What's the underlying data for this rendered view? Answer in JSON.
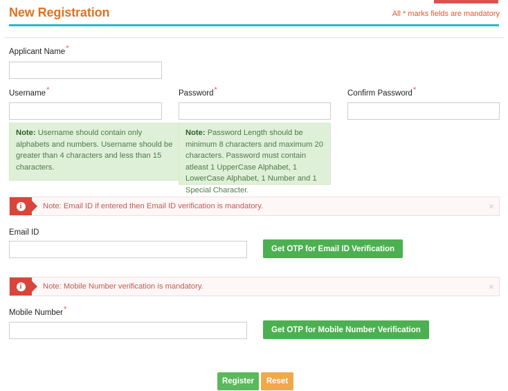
{
  "header": {
    "title": "New Registration",
    "mandatory_note": "All * marks fields are mandatory",
    "accent_color": "#d9534f",
    "title_color": "#E2711D",
    "underline_color": "#2BB8C6"
  },
  "form": {
    "applicant_name": {
      "label": "Applicant Name",
      "required": "*",
      "value": "",
      "placeholder": ""
    },
    "username": {
      "label": "Username",
      "required": "*",
      "value": "",
      "placeholder": "",
      "note_prefix": "Note:",
      "note_text": " Username should contain only alphabets and numbers. Username should be greater than 4 characters and less than 15 characters."
    },
    "password": {
      "label": "Password",
      "required": "*",
      "value": "",
      "placeholder": "",
      "note_prefix": "Note:",
      "note_text": " Password Length should be minimum 8 characters and maximum 20 characters. Password must contain atleast 1 UpperCase Alphabet, 1 LowerCase Alphabet, 1 Number and 1 Special Character."
    },
    "confirm_password": {
      "label": "Confirm Password",
      "required": "*",
      "value": "",
      "placeholder": ""
    },
    "email_alert": {
      "icon": "info-icon",
      "text": "Note: Email ID if entered then Email ID verification is mandatory.",
      "close": "×"
    },
    "email": {
      "label": "Email ID",
      "value": "",
      "placeholder": "",
      "otp_button": "Get OTP for Email ID Verification"
    },
    "mobile_alert": {
      "icon": "info-icon",
      "text": "Note: Mobile Number verification is mandatory.",
      "close": "×"
    },
    "mobile": {
      "label": "Mobile Number",
      "required": "*",
      "value": "",
      "placeholder": "",
      "otp_button": "Get OTP for Mobile Number Verification"
    }
  },
  "actions": {
    "register": "Register",
    "reset": "Reset",
    "register_color": "#5cb85c",
    "reset_color": "#efa94a"
  }
}
